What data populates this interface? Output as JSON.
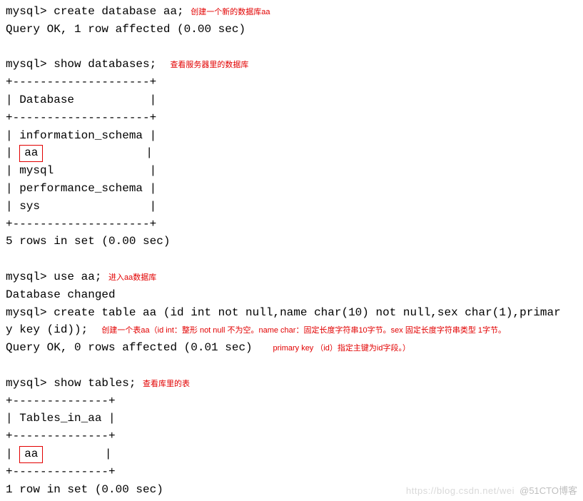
{
  "l": {
    "p1": "mysql> create database aa;",
    "a1": "创建一个新的数据库aa",
    "r1": "Query OK, 1 row affected (0.00 sec)",
    "p2": "mysql> show databases;",
    "a2": "查看服务器里的数据库",
    "sep1": "+--------------------+",
    "hdr1": "| Database           |",
    "db1": "| information_schema |",
    "db2a": "| ",
    "db2b": "aa",
    "db2c": "               |",
    "db3": "| mysql              |",
    "db4": "| performance_schema |",
    "db5": "| sys                |",
    "r2": "5 rows in set (0.00 sec)",
    "p3": "mysql> use aa;",
    "a3": "进入aa数据库",
    "r3": "Database changed",
    "p4a": "mysql> create table aa (id int not null,name char(10) not null,sex char(1),primar",
    "p4b": "y key (id));",
    "a4a": "创建一个表aa（id int：整形 not null 不为空。name char：固定长度字符串10字节。sex 固定长度字符串类型 1字节。",
    "a4b": "primary key （id）指定主键为id字段。）",
    "r4": "Query OK, 0 rows affected (0.01 sec)",
    "p5": "mysql> show tables;",
    "a5": "查看库里的表",
    "sep2": "+--------------+",
    "hdr2": "| Tables_in_aa |",
    "t1a": "| ",
    "t1b": "aa",
    "t1c": "         |",
    "r5": "1 row in set (0.00 sec)"
  },
  "wm1": "https://blog.csdn.net/wei",
  "wm2": "@51CTO博客"
}
